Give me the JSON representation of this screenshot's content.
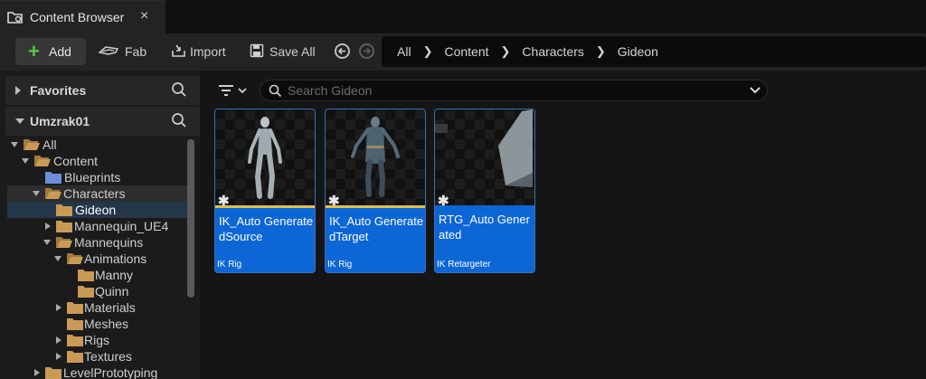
{
  "tab": {
    "title": "Content Browser",
    "close": "×"
  },
  "toolbar": {
    "add_label": "Add",
    "fab_label": "Fab",
    "import_label": "Import",
    "save_all_label": "Save All"
  },
  "breadcrumb": [
    "All",
    "Content",
    "Characters",
    "Gideon"
  ],
  "left_panel": {
    "favorites_label": "Favorites",
    "project_label": "Umzrak01",
    "tree": [
      {
        "label": "All"
      },
      {
        "label": "Content"
      },
      {
        "label": "Blueprints"
      },
      {
        "label": "Characters"
      },
      {
        "label": "Gideon"
      },
      {
        "label": "Mannequin_UE4"
      },
      {
        "label": "Mannequins"
      },
      {
        "label": "Animations"
      },
      {
        "label": "Manny"
      },
      {
        "label": "Quinn"
      },
      {
        "label": "Materials"
      },
      {
        "label": "Meshes"
      },
      {
        "label": "Rigs"
      },
      {
        "label": "Textures"
      },
      {
        "label": "LevelPrototyping"
      }
    ]
  },
  "search": {
    "placeholder": "Search Gideon"
  },
  "assets": [
    {
      "name": "IK_Auto GeneratedSource",
      "type": "IK Rig"
    },
    {
      "name": "IK_Auto GeneratedTarget",
      "type": "IK Rig"
    },
    {
      "name": "RTG_Auto Generated",
      "type": "IK Retargeter"
    }
  ],
  "colors": {
    "accent_blue": "#0d66d6",
    "folder": "#c89a55",
    "folder_blue": "#6b8fd9",
    "add_green": "#58c848",
    "rig_strip": "#e0c14a"
  }
}
